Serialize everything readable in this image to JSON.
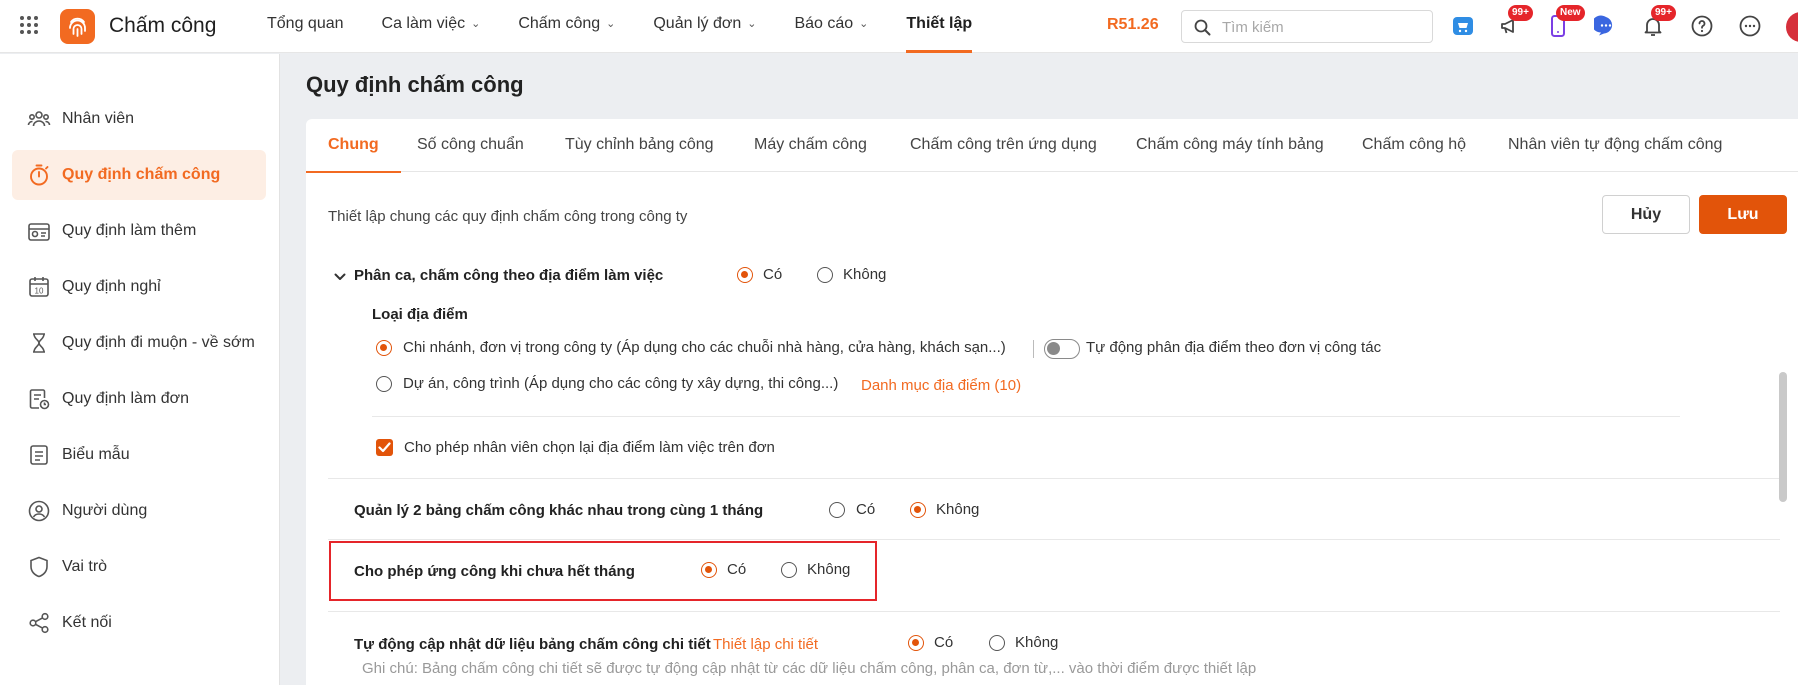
{
  "topbar": {
    "app_name": "Chấm công",
    "nav": [
      {
        "label": "Tổng quan",
        "has_dropdown": false
      },
      {
        "label": "Ca làm việc",
        "has_dropdown": true
      },
      {
        "label": "Chấm công",
        "has_dropdown": true
      },
      {
        "label": "Quản lý đơn",
        "has_dropdown": true
      },
      {
        "label": "Báo cáo",
        "has_dropdown": true
      },
      {
        "label": "Thiết lập",
        "has_dropdown": false,
        "active": true
      }
    ],
    "balance": "R51.26",
    "search_placeholder": "Tìm kiếm",
    "icons": [
      "cart-icon",
      "megaphone-icon",
      "phone-new-icon",
      "chat-icon",
      "bell-icon",
      "help-icon",
      "more-icon"
    ],
    "badges": {
      "megaphone": "99+",
      "phone": "New",
      "bell": "99+"
    },
    "accent_color": "#f26a21"
  },
  "sidebar": {
    "items": [
      {
        "label": "Nhân viên",
        "icon": "employees-icon"
      },
      {
        "label": "Quy định chấm công",
        "icon": "timer-icon",
        "active": true
      },
      {
        "label": "Quy định làm thêm",
        "icon": "overtime-icon"
      },
      {
        "label": "Quy định nghỉ",
        "icon": "calendar-icon"
      },
      {
        "label": "Quy định đi muộn - về sớm",
        "icon": "hourglass-icon"
      },
      {
        "label": "Quy định làm đơn",
        "icon": "form-clock-icon"
      },
      {
        "label": "Biểu mẫu",
        "icon": "document-icon"
      },
      {
        "label": "Người dùng",
        "icon": "user-icon"
      },
      {
        "label": "Vai trò",
        "icon": "shield-icon"
      },
      {
        "label": "Kết nối",
        "icon": "share-icon"
      }
    ]
  },
  "main": {
    "page_title": "Quy định chấm công",
    "tabs": [
      {
        "label": "Chung",
        "active": true
      },
      {
        "label": "Số công chuẩn"
      },
      {
        "label": "Tùy chỉnh bảng công"
      },
      {
        "label": "Máy chấm công"
      },
      {
        "label": "Chấm công trên ứng dụng"
      },
      {
        "label": "Chấm công máy tính bảng"
      },
      {
        "label": "Chấm công hộ"
      },
      {
        "label": "Nhân viên tự động chấm công"
      }
    ],
    "description": "Thiết lập chung các quy định chấm công trong công ty",
    "cancel_label": "Hủy",
    "save_label": "Lưu",
    "yes_label": "Có",
    "no_label": "Không",
    "settings": {
      "location_shift": {
        "label": "Phân ca, chấm công theo địa điểm làm việc",
        "value": "Có",
        "location_type_label": "Loại địa điểm",
        "option_branch": "Chi nhánh, đơn vị trong công ty (Áp dụng cho các chuỗi nhà hàng, cửa hàng, khách sạn...)",
        "option_project": "Dự án, công trình (Áp dụng cho các công ty xây dựng, thi công...)",
        "selected_option": "branch",
        "auto_assign_label": "Tự động phân địa điểm theo đơn vị công tác",
        "auto_assign_on": false,
        "location_list_link": "Danh mục địa điểm (10)",
        "allow_reselect_label": "Cho phép nhân viên chọn lại địa điểm làm việc trên đơn",
        "allow_reselect_checked": true
      },
      "two_tables": {
        "label": "Quản lý 2 bảng chấm công khác nhau trong cùng 1 tháng",
        "value": "Không"
      },
      "advance": {
        "label": "Cho phép ứng công khi chưa hết tháng",
        "value": "Có"
      },
      "auto_update": {
        "label": "Tự động cập nhật dữ liệu bảng chấm công chi tiết",
        "link": "Thiết lập chi tiết",
        "value": "Có",
        "note": "Ghi chú: Bảng chấm công chi tiết sẽ được tự động cập nhật từ các dữ liệu chấm công, phân ca, đơn từ,... vào thời điểm được thiết lập"
      }
    }
  }
}
